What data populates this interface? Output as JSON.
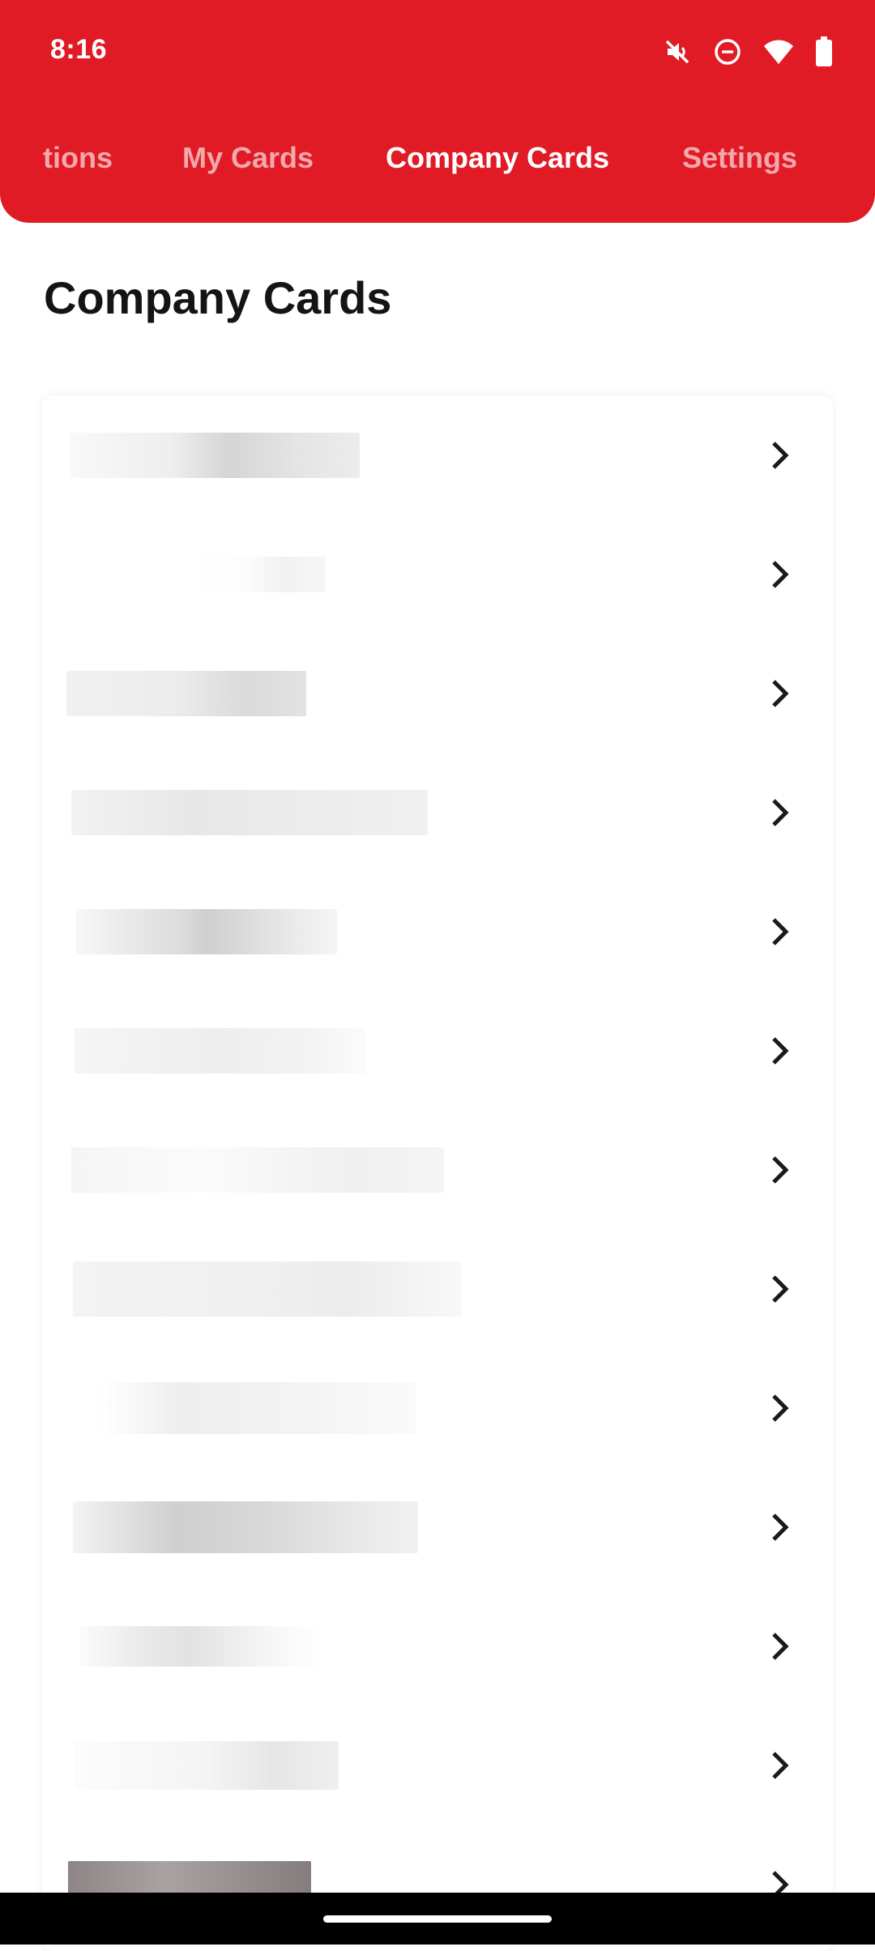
{
  "status_bar": {
    "time": "8:16",
    "icons": [
      "mute-icon",
      "do-not-disturb-icon",
      "wifi-icon",
      "battery-icon"
    ]
  },
  "tabs": [
    {
      "label": "tions",
      "active": false
    },
    {
      "label": "My Cards",
      "active": false
    },
    {
      "label": "Company Cards",
      "active": true
    },
    {
      "label": "Settings",
      "active": false
    }
  ],
  "page": {
    "title": "Company Cards"
  },
  "card_list": {
    "item_count": 13,
    "item_names": "redacted (pixelated)",
    "item_icon": "chevron-right-icon"
  },
  "colors": {
    "brand_red": "#e01b26",
    "background": "#ffffff",
    "title_text": "#141414"
  }
}
